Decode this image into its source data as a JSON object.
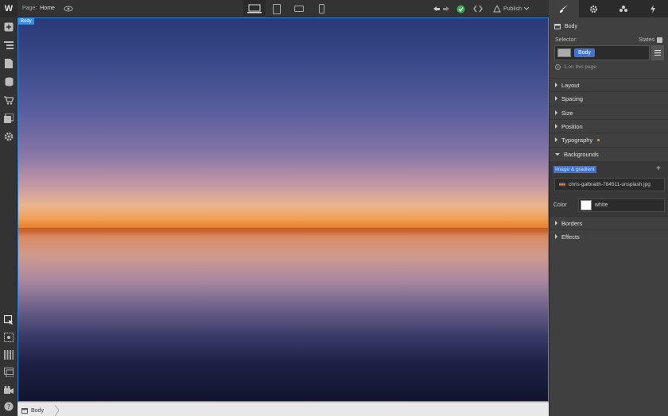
{
  "topbar": {
    "logo": "W",
    "page_prefix": "Page:",
    "page_name": "Home",
    "publish_label": "Publish"
  },
  "canvas": {
    "element_tag": "Body"
  },
  "breadcrumb": {
    "item": "Body"
  },
  "panel": {
    "header": "Body",
    "selector_label": "Selector:",
    "states_label": "States",
    "selector_value": "Body",
    "on_page": "1 on this page",
    "sections": {
      "layout": "Layout",
      "spacing": "Spacing",
      "size": "Size",
      "position": "Position",
      "typography": "Typography",
      "backgrounds": "Backgrounds",
      "borders": "Borders",
      "effects": "Effects"
    },
    "backgrounds": {
      "image_gradient_label": "Image & gradient",
      "layer_file": "chris-galbraith-784511-unsplash.jpg",
      "color_label": "Color",
      "color_value": "white"
    }
  },
  "colors": {
    "accent": "#3b74d6",
    "success": "#36b34a",
    "modified_dot": "#f0a030"
  }
}
